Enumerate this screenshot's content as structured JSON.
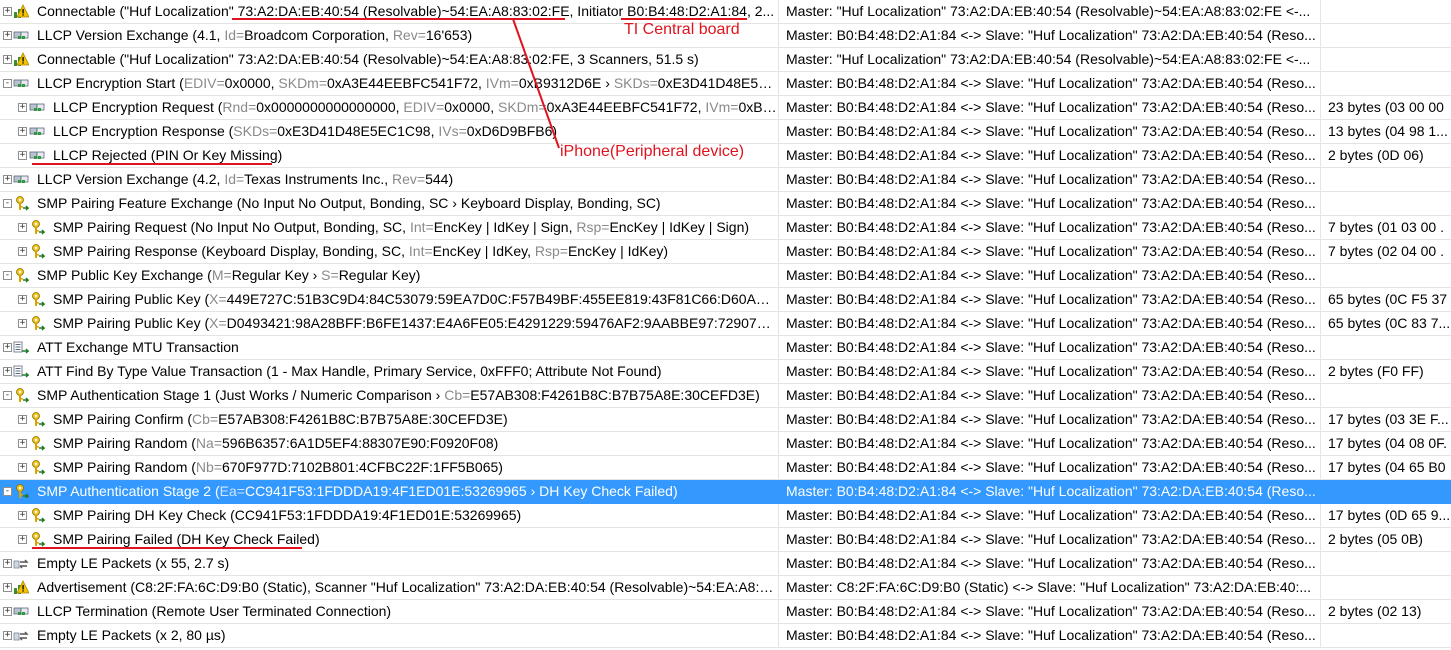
{
  "rows": [
    {
      "level": 0,
      "exp": "+",
      "icon": "warn",
      "parts": [
        [
          "Connectable (\"Huf Localization\" 73:A2:DA:EB:40:54 (Resolvable)~54:EA:A8:83:02:FE, Initiator B0:B4:48:D2:A1:84, 2...",
          ""
        ]
      ],
      "master": "Master: \"Huf Localization\" 73:A2:DA:EB:40:54 (Resolvable)~54:EA:A8:83:02:FE <-...",
      "extra": ""
    },
    {
      "level": 0,
      "exp": "+",
      "icon": "llcp",
      "parts": [
        [
          "LLCP Version Exchange (4.1, ",
          ""
        ],
        [
          "Id=",
          "g"
        ],
        [
          "Broadcom Corporation, ",
          ""
        ],
        [
          "Rev=",
          "g"
        ],
        [
          "16'653)",
          ""
        ]
      ],
      "master": "Master: B0:B4:48:D2:A1:84 <-> Slave: \"Huf Localization\" 73:A2:DA:EB:40:54 (Reso...",
      "extra": ""
    },
    {
      "level": 0,
      "exp": "+",
      "icon": "warn",
      "parts": [
        [
          "Connectable (\"Huf Localization\" 73:A2:DA:EB:40:54 (Resolvable)~54:EA:A8:83:02:FE, 3 Scanners, 51.5 s)",
          ""
        ]
      ],
      "master": "Master: \"Huf Localization\" 73:A2:DA:EB:40:54 (Resolvable)~54:EA:A8:83:02:FE <-...",
      "extra": ""
    },
    {
      "level": 0,
      "exp": "-",
      "icon": "llcp",
      "parts": [
        [
          "LLCP Encryption Start (",
          ""
        ],
        [
          "EDIV=",
          "g"
        ],
        [
          "0x0000, ",
          ""
        ],
        [
          "SKDm=",
          "g"
        ],
        [
          "0xA3E44EEBFC541F72, ",
          ""
        ],
        [
          "IVm=",
          "g"
        ],
        [
          "0xB9312D6E › ",
          ""
        ],
        [
          "SKDs=",
          "g"
        ],
        [
          "0xE3D41D48E5E...",
          ""
        ]
      ],
      "master": "Master: B0:B4:48:D2:A1:84 <-> Slave: \"Huf Localization\" 73:A2:DA:EB:40:54 (Reso...",
      "extra": ""
    },
    {
      "level": 1,
      "exp": "+",
      "icon": "llcp",
      "parts": [
        [
          "LLCP Encryption Request (",
          ""
        ],
        [
          "Rnd=",
          "g"
        ],
        [
          "0x0000000000000000, ",
          ""
        ],
        [
          "EDIV=",
          "g"
        ],
        [
          "0x0000, ",
          ""
        ],
        [
          "SKDm=",
          "g"
        ],
        [
          "0xA3E44EEBFC541F72, ",
          ""
        ],
        [
          "IVm=",
          "g"
        ],
        [
          "0xB9...",
          ""
        ]
      ],
      "master": "Master: B0:B4:48:D2:A1:84 <-> Slave: \"Huf Localization\" 73:A2:DA:EB:40:54 (Reso...",
      "extra": "23 bytes (03 00 00"
    },
    {
      "level": 1,
      "exp": "+",
      "icon": "llcp",
      "parts": [
        [
          "LLCP Encryption Response (",
          ""
        ],
        [
          "SKDs=",
          "g"
        ],
        [
          "0xE3D41D48E5EC1C98, ",
          ""
        ],
        [
          "IVs=",
          "g"
        ],
        [
          "0xD6D9BFB6)",
          ""
        ]
      ],
      "master": "Master: B0:B4:48:D2:A1:84 <-> Slave: \"Huf Localization\" 73:A2:DA:EB:40:54 (Reso...",
      "extra": "13 bytes (04 98 1..."
    },
    {
      "level": 1,
      "exp": "+",
      "icon": "llcp",
      "parts": [
        [
          "LLCP Rejected (PIN Or Key Missing)",
          ""
        ]
      ],
      "master": "Master: B0:B4:48:D2:A1:84 <-> Slave: \"Huf Localization\" 73:A2:DA:EB:40:54 (Reso...",
      "extra": "2 bytes (0D 06)"
    },
    {
      "level": 0,
      "exp": "+",
      "icon": "llcp",
      "parts": [
        [
          "LLCP Version Exchange (4.2, ",
          ""
        ],
        [
          "Id=",
          "g"
        ],
        [
          "Texas Instruments Inc., ",
          ""
        ],
        [
          "Rev=",
          "g"
        ],
        [
          "544)",
          ""
        ]
      ],
      "master": "Master: B0:B4:48:D2:A1:84 <-> Slave: \"Huf Localization\" 73:A2:DA:EB:40:54 (Reso...",
      "extra": ""
    },
    {
      "level": 0,
      "exp": "-",
      "icon": "key",
      "parts": [
        [
          "SMP Pairing Feature Exchange (No Input No Output, Bonding, SC › Keyboard Display, Bonding, SC)",
          ""
        ]
      ],
      "master": "Master: B0:B4:48:D2:A1:84 <-> Slave: \"Huf Localization\" 73:A2:DA:EB:40:54 (Reso...",
      "extra": ""
    },
    {
      "level": 1,
      "exp": "+",
      "icon": "key",
      "parts": [
        [
          "SMP Pairing Request (No Input No Output, Bonding, SC, ",
          ""
        ],
        [
          "Int=",
          "g"
        ],
        [
          "EncKey | IdKey | Sign, ",
          ""
        ],
        [
          "Rsp=",
          "g"
        ],
        [
          "EncKey | IdKey | Sign)",
          ""
        ]
      ],
      "master": "Master: B0:B4:48:D2:A1:84 <-> Slave: \"Huf Localization\" 73:A2:DA:EB:40:54 (Reso...",
      "extra": "7 bytes (01 03 00 ."
    },
    {
      "level": 1,
      "exp": "+",
      "icon": "key",
      "parts": [
        [
          "SMP Pairing Response (Keyboard Display, Bonding, SC, ",
          ""
        ],
        [
          "Int=",
          "g"
        ],
        [
          "EncKey | IdKey, ",
          ""
        ],
        [
          "Rsp=",
          "g"
        ],
        [
          "EncKey | IdKey)",
          ""
        ]
      ],
      "master": "Master: B0:B4:48:D2:A1:84 <-> Slave: \"Huf Localization\" 73:A2:DA:EB:40:54 (Reso...",
      "extra": "7 bytes (02 04 00 ."
    },
    {
      "level": 0,
      "exp": "-",
      "icon": "key",
      "parts": [
        [
          "SMP Public Key Exchange (",
          ""
        ],
        [
          "M=",
          "g"
        ],
        [
          "Regular Key › ",
          ""
        ],
        [
          "S=",
          "g"
        ],
        [
          "Regular Key)",
          ""
        ]
      ],
      "master": "Master: B0:B4:48:D2:A1:84 <-> Slave: \"Huf Localization\" 73:A2:DA:EB:40:54 (Reso...",
      "extra": ""
    },
    {
      "level": 1,
      "exp": "+",
      "icon": "key",
      "parts": [
        [
          "SMP Pairing Public Key (",
          ""
        ],
        [
          "X=",
          "g"
        ],
        [
          "449E727C:51B3C9D4:84C53079:59EA7D0C:F57B49BF:455EE819:43F81C66:D60A37F...",
          ""
        ]
      ],
      "master": "Master: B0:B4:48:D2:A1:84 <-> Slave: \"Huf Localization\" 73:A2:DA:EB:40:54 (Reso...",
      "extra": "65 bytes (0C F5 37"
    },
    {
      "level": 1,
      "exp": "+",
      "icon": "key",
      "parts": [
        [
          "SMP Pairing Public Key (",
          ""
        ],
        [
          "X=",
          "g"
        ],
        [
          "D0493421:98A28BFF:B6FE1437:E4A6FE05:E4291229:59476AF2:9AABBE97:72907E83, ",
          ""
        ],
        [
          "Y...",
          "g"
        ]
      ],
      "master": "Master: B0:B4:48:D2:A1:84 <-> Slave: \"Huf Localization\" 73:A2:DA:EB:40:54 (Reso...",
      "extra": "65 bytes (0C 83 7..."
    },
    {
      "level": 0,
      "exp": "+",
      "icon": "att",
      "parts": [
        [
          "ATT Exchange MTU Transaction",
          ""
        ]
      ],
      "master": "Master: B0:B4:48:D2:A1:84 <-> Slave: \"Huf Localization\" 73:A2:DA:EB:40:54 (Reso...",
      "extra": ""
    },
    {
      "level": 0,
      "exp": "+",
      "icon": "att",
      "parts": [
        [
          "ATT Find By Type Value Transaction (1 - Max Handle, Primary Service, 0xFFF0; Attribute Not Found)",
          ""
        ]
      ],
      "master": "Master: B0:B4:48:D2:A1:84 <-> Slave: \"Huf Localization\" 73:A2:DA:EB:40:54 (Reso...",
      "extra": "2 bytes (F0 FF)"
    },
    {
      "level": 0,
      "exp": "-",
      "icon": "key",
      "parts": [
        [
          "SMP Authentication Stage 1 (Just Works / Numeric Comparison › ",
          ""
        ],
        [
          "Cb=",
          "g"
        ],
        [
          "E57AB308:F4261B8C:B7B75A8E:30CEFD3E)",
          ""
        ]
      ],
      "master": "Master: B0:B4:48:D2:A1:84 <-> Slave: \"Huf Localization\" 73:A2:DA:EB:40:54 (Reso...",
      "extra": ""
    },
    {
      "level": 1,
      "exp": "+",
      "icon": "key",
      "parts": [
        [
          "SMP Pairing Confirm (",
          ""
        ],
        [
          "Cb=",
          "g"
        ],
        [
          "E57AB308:F4261B8C:B7B75A8E:30CEFD3E)",
          ""
        ]
      ],
      "master": "Master: B0:B4:48:D2:A1:84 <-> Slave: \"Huf Localization\" 73:A2:DA:EB:40:54 (Reso...",
      "extra": "17 bytes (03 3E F..."
    },
    {
      "level": 1,
      "exp": "+",
      "icon": "key",
      "parts": [
        [
          "SMP Pairing Random (",
          ""
        ],
        [
          "Na=",
          "g"
        ],
        [
          "596B6357:6A1D5EF4:88307E90:F0920F08)",
          ""
        ]
      ],
      "master": "Master: B0:B4:48:D2:A1:84 <-> Slave: \"Huf Localization\" 73:A2:DA:EB:40:54 (Reso...",
      "extra": "17 bytes (04 08 0F."
    },
    {
      "level": 1,
      "exp": "+",
      "icon": "key",
      "parts": [
        [
          "SMP Pairing Random (",
          ""
        ],
        [
          "Nb=",
          "g"
        ],
        [
          "670F977D:7102B801:4CFBC22F:1FF5B065)",
          ""
        ]
      ],
      "master": "Master: B0:B4:48:D2:A1:84 <-> Slave: \"Huf Localization\" 73:A2:DA:EB:40:54 (Reso...",
      "extra": "17 bytes (04 65 B0"
    },
    {
      "level": 0,
      "exp": "-",
      "icon": "key",
      "selected": true,
      "parts": [
        [
          "SMP Authentication Stage 2 (",
          ""
        ],
        [
          "Ea=",
          "g"
        ],
        [
          "CC941F53:1FDDDA19:4F1ED01E:53269965 › DH Key Check Failed)",
          ""
        ]
      ],
      "master": "Master: B0:B4:48:D2:A1:84 <-> Slave: \"Huf Localization\" 73:A2:DA:EB:40:54 (Reso...",
      "extra": ""
    },
    {
      "level": 1,
      "exp": "+",
      "icon": "key",
      "parts": [
        [
          "SMP Pairing DH Key Check (CC941F53:1FDDDA19:4F1ED01E:53269965)",
          ""
        ]
      ],
      "master": "Master: B0:B4:48:D2:A1:84 <-> Slave: \"Huf Localization\" 73:A2:DA:EB:40:54 (Reso...",
      "extra": "17 bytes (0D 65 9..."
    },
    {
      "level": 1,
      "exp": "+",
      "icon": "key",
      "parts": [
        [
          "SMP Pairing Failed (DH Key Check Failed)",
          ""
        ]
      ],
      "master": "Master: B0:B4:48:D2:A1:84 <-> Slave: \"Huf Localization\" 73:A2:DA:EB:40:54 (Reso...",
      "extra": "2 bytes (05 0B)"
    },
    {
      "level": 0,
      "exp": "+",
      "icon": "empty",
      "parts": [
        [
          "Empty LE Packets (x 55, 2.7 s)",
          ""
        ]
      ],
      "master": "Master: B0:B4:48:D2:A1:84 <-> Slave: \"Huf Localization\" 73:A2:DA:EB:40:54 (Reso...",
      "extra": ""
    },
    {
      "level": 0,
      "exp": "+",
      "icon": "warn",
      "parts": [
        [
          "Advertisement (C8:2F:FA:6C:D9:B0 (Static), Scanner \"Huf Localization\" 73:A2:DA:EB:40:54 (Resolvable)~54:EA:A8:8...",
          ""
        ]
      ],
      "master": "Master: C8:2F:FA:6C:D9:B0 (Static) <-> Slave: \"Huf Localization\" 73:A2:DA:EB:40:...",
      "extra": ""
    },
    {
      "level": 0,
      "exp": "+",
      "icon": "llcp",
      "parts": [
        [
          "LLCP Termination (Remote User Terminated Connection)",
          ""
        ]
      ],
      "master": "Master: B0:B4:48:D2:A1:84 <-> Slave: \"Huf Localization\" 73:A2:DA:EB:40:54 (Reso...",
      "extra": "2 bytes (02 13)"
    },
    {
      "level": 0,
      "exp": "+",
      "icon": "empty",
      "parts": [
        [
          "Empty LE Packets (x 2, 80 µs)",
          ""
        ]
      ],
      "master": "Master: B0:B4:48:D2:A1:84 <-> Slave: \"Huf Localization\" 73:A2:DA:EB:40:54 (Reso...",
      "extra": ""
    }
  ],
  "annotations": {
    "central": "TI Central board",
    "peripheral": "iPhone(Peripheral device)"
  },
  "colors": {
    "selection": "#3399ff",
    "annotation": "#e0141e",
    "grey_label": "#8a8a8a"
  },
  "icon_names": {
    "warn": "advertising-warning-icon",
    "llcp": "llcp-link-icon",
    "key": "smp-key-icon",
    "att": "att-transaction-icon",
    "empty": "empty-packets-icon"
  }
}
